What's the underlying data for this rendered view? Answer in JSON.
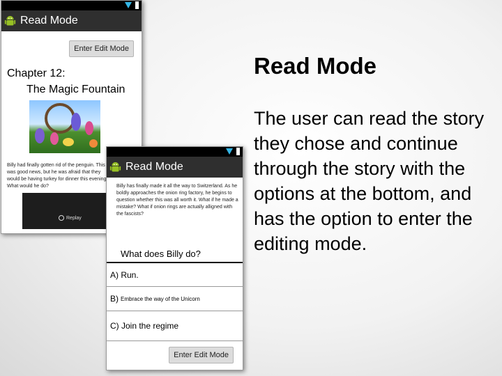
{
  "slide": {
    "title": "Read Mode",
    "body": "The user can read the story they chose and continue through the story with the options at the bottom, and has the option to enter the editing mode."
  },
  "screen1": {
    "app_title": "Read Mode",
    "edit_button": "Enter Edit Mode",
    "chapter": "Chapter 12:",
    "chapter_title": "The Magic Fountain",
    "story_text": "Billy had finally gotten rid of the penguin. This was good news, but he was afraid that they would be having turkey for dinner this evening. What would he do?",
    "video_label": "Replay"
  },
  "screen2": {
    "app_title": "Read Mode",
    "story_text": "Billy has finally made it all the way to Switzerland. As he boldly approaches the onion ring factory, he begins to question whether this was all worth it. What if he made a mistake? What if onion rings are actually alligned with the fascists?",
    "question": "What does Billy do?",
    "option_a": "A) Run.",
    "option_b_prefix": "B)",
    "option_b_text": "Embrace the way of the Unicorn",
    "option_c": "C) Join the regime",
    "edit_button": "Enter Edit Mode"
  },
  "colors": {
    "action_bar": "#2f2f2f",
    "status_bar": "#000000",
    "android_green": "#97c024",
    "wifi_blue": "#33b5e5"
  },
  "icons": [
    "android-icon",
    "wifi-icon",
    "battery-icon",
    "replay-icon"
  ]
}
